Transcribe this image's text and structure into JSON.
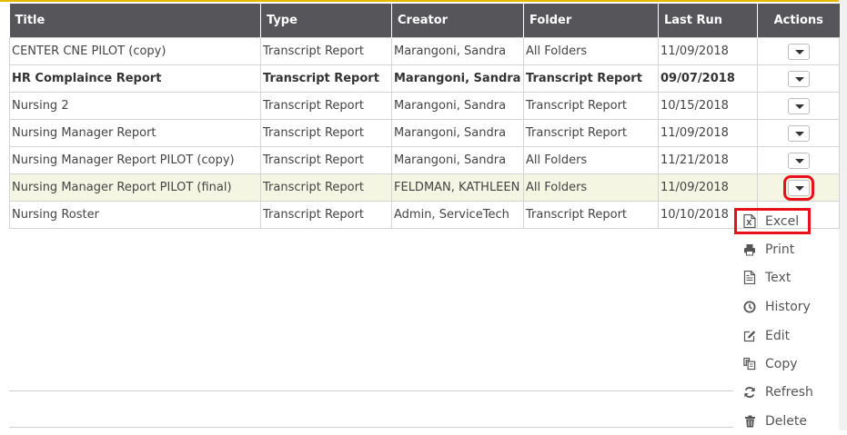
{
  "columns": [
    "Title",
    "Type",
    "Creator",
    "Folder",
    "Last Run",
    "Actions"
  ],
  "rows": [
    {
      "title": "CENTER CNE PILOT (copy)",
      "type": "Transcript Report",
      "creator": "Marangoni, Sandra",
      "folder": "All Folders",
      "last_run": "11/09/2018"
    },
    {
      "title": "HR Complaince Report",
      "type": "Transcript Report",
      "creator": "Marangoni, Sandra",
      "folder": "Transcript Report",
      "last_run": "09/07/2018"
    },
    {
      "title": "Nursing 2",
      "type": "Transcript Report",
      "creator": "Marangoni, Sandra",
      "folder": "Transcript Report",
      "last_run": "10/15/2018"
    },
    {
      "title": "Nursing Manager Report",
      "type": "Transcript Report",
      "creator": "Marangoni, Sandra",
      "folder": "Transcript Report",
      "last_run": "11/09/2018"
    },
    {
      "title": "Nursing Manager Report PILOT (copy)",
      "type": "Transcript Report",
      "creator": "Marangoni, Sandra",
      "folder": "All Folders",
      "last_run": "11/21/2018"
    },
    {
      "title": "Nursing Manager Report PILOT (final)",
      "type": "Transcript Report",
      "creator": "FELDMAN, KATHLEEN",
      "folder": "All Folders",
      "last_run": "11/09/2018"
    },
    {
      "title": "Nursing Roster",
      "type": "Transcript Report",
      "creator": "Admin, ServiceTech",
      "folder": "Transcript Report",
      "last_run": "10/10/2018"
    }
  ],
  "actions_menu": {
    "items": [
      {
        "label": "Excel",
        "icon": "excel-icon"
      },
      {
        "label": "Print",
        "icon": "print-icon"
      },
      {
        "label": "Text",
        "icon": "text-file-icon"
      },
      {
        "label": "History",
        "icon": "history-icon"
      },
      {
        "label": "Edit",
        "icon": "edit-icon"
      },
      {
        "label": "Copy",
        "icon": "copy-icon"
      },
      {
        "label": "Refresh",
        "icon": "refresh-icon"
      },
      {
        "label": "Delete",
        "icon": "trash-icon"
      }
    ]
  },
  "colors": {
    "header_bg": "#55555a",
    "highlight_row": "#f4f5e3",
    "callout_red": "#e8101a",
    "top_accent": "#e6b800"
  }
}
